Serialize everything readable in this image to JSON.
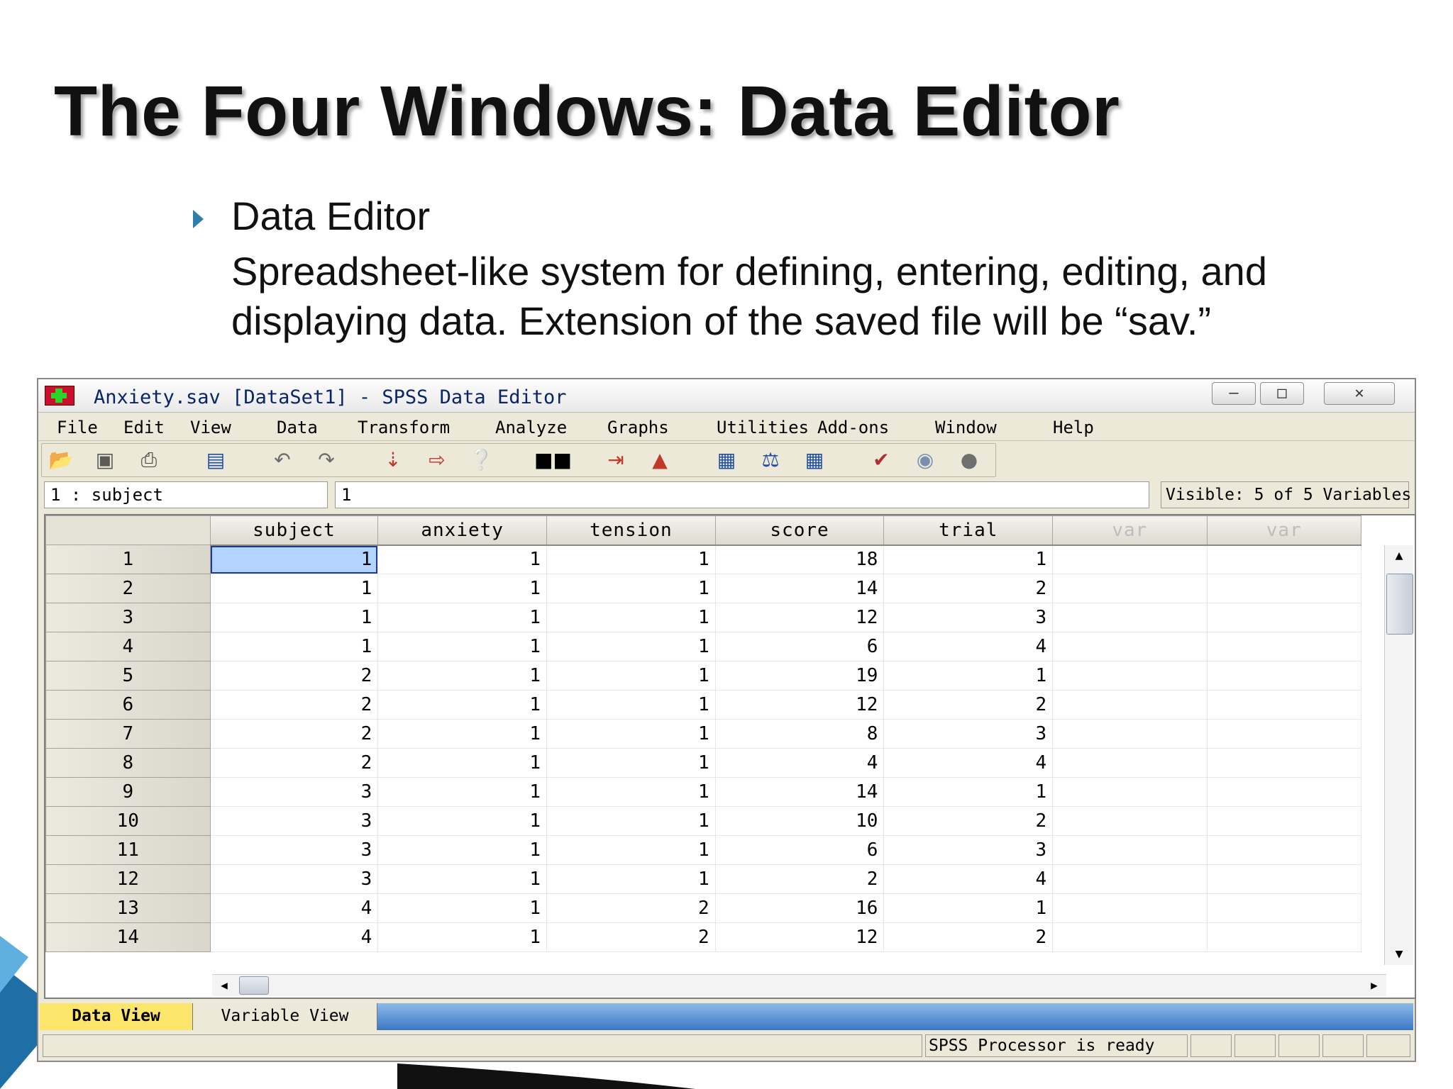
{
  "slide": {
    "title": "The Four Windows: Data Editor",
    "bullet_heading": "Data Editor",
    "bullet_body": "Spreadsheet-like system for defining, entering, editing, and displaying data. Extension of the saved file will be “sav.”"
  },
  "window": {
    "title": "Anxiety.sav [DataSet1] - SPSS Data Editor",
    "controls": {
      "minimize": "–",
      "maximize": "□",
      "close": "✕"
    },
    "menu": [
      "File",
      "Edit",
      "View",
      "Data",
      "Transform",
      "Analyze",
      "Graphs",
      "Utilities",
      "Add-ons",
      "Window",
      "Help"
    ],
    "toolbar_icons": [
      "open-icon",
      "save-icon",
      "print-icon",
      "dialog-recall-icon",
      "undo-icon",
      "redo-icon",
      "go-to-case-icon",
      "insert-cases-icon",
      "variables-icon",
      "find-icon",
      "insert-variable-icon",
      "split-file-icon",
      "value-labels-icon",
      "weight-cases-icon",
      "select-cases-icon",
      "use-sets-icon",
      "show-all-icon",
      "spell-check-icon"
    ],
    "cell_reference": "1 : subject",
    "cell_value": "1",
    "visible_label": "Visible: 5 of 5 Variables",
    "columns": [
      "subject",
      "anxiety",
      "tension",
      "score",
      "trial",
      "var",
      "var"
    ],
    "rows": [
      {
        "n": "1",
        "values": [
          "1",
          "1",
          "1",
          "18",
          "1"
        ]
      },
      {
        "n": "2",
        "values": [
          "1",
          "1",
          "1",
          "14",
          "2"
        ]
      },
      {
        "n": "3",
        "values": [
          "1",
          "1",
          "1",
          "12",
          "3"
        ]
      },
      {
        "n": "4",
        "values": [
          "1",
          "1",
          "1",
          "6",
          "4"
        ]
      },
      {
        "n": "5",
        "values": [
          "2",
          "1",
          "1",
          "19",
          "1"
        ]
      },
      {
        "n": "6",
        "values": [
          "2",
          "1",
          "1",
          "12",
          "2"
        ]
      },
      {
        "n": "7",
        "values": [
          "2",
          "1",
          "1",
          "8",
          "3"
        ]
      },
      {
        "n": "8",
        "values": [
          "2",
          "1",
          "1",
          "4",
          "4"
        ]
      },
      {
        "n": "9",
        "values": [
          "3",
          "1",
          "1",
          "14",
          "1"
        ]
      },
      {
        "n": "10",
        "values": [
          "3",
          "1",
          "1",
          "10",
          "2"
        ]
      },
      {
        "n": "11",
        "values": [
          "3",
          "1",
          "1",
          "6",
          "3"
        ]
      },
      {
        "n": "12",
        "values": [
          "3",
          "1",
          "1",
          "2",
          "4"
        ]
      },
      {
        "n": "13",
        "values": [
          "4",
          "1",
          "2",
          "16",
          "1"
        ]
      },
      {
        "n": "14",
        "values": [
          "4",
          "1",
          "2",
          "12",
          "2"
        ]
      }
    ],
    "tabs": [
      "Data View",
      "Variable View"
    ],
    "status": "SPSS  Processor is ready"
  }
}
